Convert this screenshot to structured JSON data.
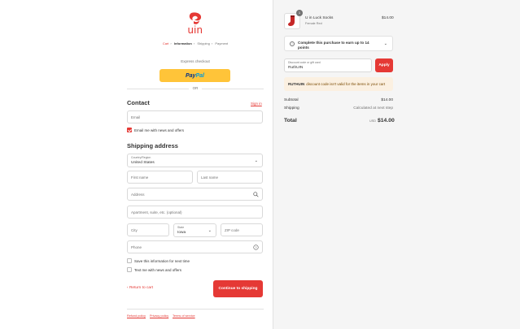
{
  "brand": {
    "logo_text": "uin",
    "accent": "#e53935"
  },
  "breadcrumb": [
    "Cart",
    "Information",
    "Shipping",
    "Payment"
  ],
  "express": {
    "label": "Express checkout",
    "paypal_part1": "Pay",
    "paypal_part2": "Pal",
    "or": "OR"
  },
  "contact": {
    "heading": "Contact",
    "signin": "Sign in",
    "email_placeholder": "Email",
    "news_label": "Email me with news and offers",
    "news_checked": true
  },
  "shipping": {
    "heading": "Shipping address",
    "country_label": "Country/Region",
    "country_value": "United States",
    "first_name": "First name",
    "last_name": "Last name",
    "address": "Address",
    "apartment": "Apartment, suite, etc. (optional)",
    "city": "City",
    "state_label": "State",
    "state_value": "Iowa",
    "zip": "ZIP code",
    "phone": "Phone",
    "save_label": "Save this information for next time",
    "text_label": "Text me with news and offers"
  },
  "actions": {
    "return": "Return to cart",
    "continue": "Continue to shipping"
  },
  "footer": [
    "Refund policy",
    "Privacy policy",
    "Terms of service"
  ],
  "summary": {
    "item": {
      "qty": "1",
      "name": "U in Luck Socks",
      "variant": "Female Red",
      "price": "$14.00"
    },
    "points_text": "Complete this purchase to earn up to 14 points",
    "discount_label": "Discount code or gift card",
    "discount_value": "RuthUIN",
    "apply": "Apply",
    "warning_code": "RUTHUIN",
    "warning_text": "discount code isn't valid for the items in your cart",
    "subtotal_label": "Subtotal",
    "subtotal_value": "$14.00",
    "shipping_label": "Shipping",
    "shipping_value": "Calculated at next step",
    "total_label": "Total",
    "currency": "USD",
    "total_value": "$14.00"
  }
}
